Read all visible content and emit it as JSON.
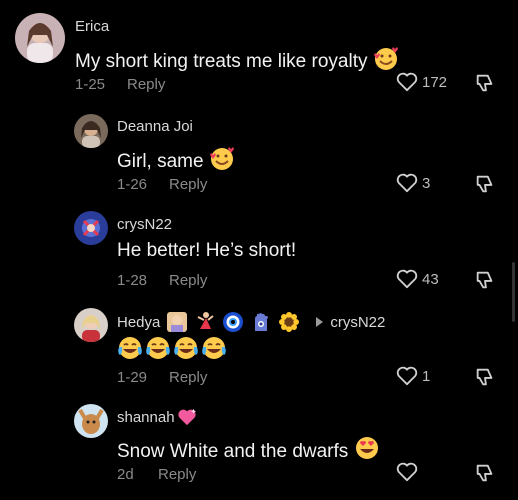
{
  "comments": [
    {
      "username": "Erica",
      "text": "My short king treats me like royalty",
      "date": "1-25",
      "reply_label": "Reply",
      "likes": "172"
    },
    {
      "username": "Deanna Joi",
      "text": "Girl, same",
      "date": "1-26",
      "reply_label": "Reply",
      "likes": "3"
    },
    {
      "username": "crysN22",
      "text": "He better! He’s short!",
      "date": "1-28",
      "reply_label": "Reply",
      "likes": "43"
    },
    {
      "username": "Hedya",
      "reply_to": "crysN22",
      "date": "1-29",
      "reply_label": "Reply",
      "likes": "1"
    },
    {
      "username": "shannah",
      "text": "Snow White and the dwarfs",
      "date": "2d",
      "reply_label": "Reply",
      "likes": ""
    }
  ],
  "icons": {
    "like": "heart-outline-icon",
    "dislike": "thumbs-down-icon",
    "reply_arrow": "triangle-right-icon"
  },
  "colors": {
    "background": "#000000",
    "text": "#f2f2f2",
    "meta": "#8a8a8a"
  }
}
